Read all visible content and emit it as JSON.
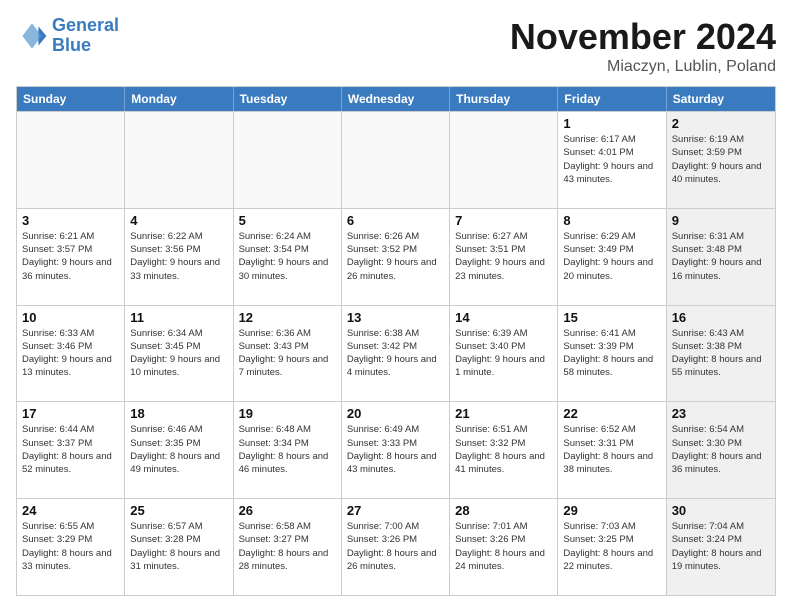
{
  "logo": {
    "line1": "General",
    "line2": "Blue"
  },
  "title": "November 2024",
  "location": "Miaczyn, Lublin, Poland",
  "weekdays": [
    "Sunday",
    "Monday",
    "Tuesday",
    "Wednesday",
    "Thursday",
    "Friday",
    "Saturday"
  ],
  "rows": [
    [
      {
        "day": "",
        "info": "",
        "empty": true
      },
      {
        "day": "",
        "info": "",
        "empty": true
      },
      {
        "day": "",
        "info": "",
        "empty": true
      },
      {
        "day": "",
        "info": "",
        "empty": true
      },
      {
        "day": "",
        "info": "",
        "empty": true
      },
      {
        "day": "1",
        "info": "Sunrise: 6:17 AM\nSunset: 4:01 PM\nDaylight: 9 hours and 43 minutes."
      },
      {
        "day": "2",
        "info": "Sunrise: 6:19 AM\nSunset: 3:59 PM\nDaylight: 9 hours and 40 minutes.",
        "shaded": true
      }
    ],
    [
      {
        "day": "3",
        "info": "Sunrise: 6:21 AM\nSunset: 3:57 PM\nDaylight: 9 hours and 36 minutes."
      },
      {
        "day": "4",
        "info": "Sunrise: 6:22 AM\nSunset: 3:56 PM\nDaylight: 9 hours and 33 minutes."
      },
      {
        "day": "5",
        "info": "Sunrise: 6:24 AM\nSunset: 3:54 PM\nDaylight: 9 hours and 30 minutes."
      },
      {
        "day": "6",
        "info": "Sunrise: 6:26 AM\nSunset: 3:52 PM\nDaylight: 9 hours and 26 minutes."
      },
      {
        "day": "7",
        "info": "Sunrise: 6:27 AM\nSunset: 3:51 PM\nDaylight: 9 hours and 23 minutes."
      },
      {
        "day": "8",
        "info": "Sunrise: 6:29 AM\nSunset: 3:49 PM\nDaylight: 9 hours and 20 minutes."
      },
      {
        "day": "9",
        "info": "Sunrise: 6:31 AM\nSunset: 3:48 PM\nDaylight: 9 hours and 16 minutes.",
        "shaded": true
      }
    ],
    [
      {
        "day": "10",
        "info": "Sunrise: 6:33 AM\nSunset: 3:46 PM\nDaylight: 9 hours and 13 minutes."
      },
      {
        "day": "11",
        "info": "Sunrise: 6:34 AM\nSunset: 3:45 PM\nDaylight: 9 hours and 10 minutes."
      },
      {
        "day": "12",
        "info": "Sunrise: 6:36 AM\nSunset: 3:43 PM\nDaylight: 9 hours and 7 minutes."
      },
      {
        "day": "13",
        "info": "Sunrise: 6:38 AM\nSunset: 3:42 PM\nDaylight: 9 hours and 4 minutes."
      },
      {
        "day": "14",
        "info": "Sunrise: 6:39 AM\nSunset: 3:40 PM\nDaylight: 9 hours and 1 minute."
      },
      {
        "day": "15",
        "info": "Sunrise: 6:41 AM\nSunset: 3:39 PM\nDaylight: 8 hours and 58 minutes."
      },
      {
        "day": "16",
        "info": "Sunrise: 6:43 AM\nSunset: 3:38 PM\nDaylight: 8 hours and 55 minutes.",
        "shaded": true
      }
    ],
    [
      {
        "day": "17",
        "info": "Sunrise: 6:44 AM\nSunset: 3:37 PM\nDaylight: 8 hours and 52 minutes."
      },
      {
        "day": "18",
        "info": "Sunrise: 6:46 AM\nSunset: 3:35 PM\nDaylight: 8 hours and 49 minutes."
      },
      {
        "day": "19",
        "info": "Sunrise: 6:48 AM\nSunset: 3:34 PM\nDaylight: 8 hours and 46 minutes."
      },
      {
        "day": "20",
        "info": "Sunrise: 6:49 AM\nSunset: 3:33 PM\nDaylight: 8 hours and 43 minutes."
      },
      {
        "day": "21",
        "info": "Sunrise: 6:51 AM\nSunset: 3:32 PM\nDaylight: 8 hours and 41 minutes."
      },
      {
        "day": "22",
        "info": "Sunrise: 6:52 AM\nSunset: 3:31 PM\nDaylight: 8 hours and 38 minutes."
      },
      {
        "day": "23",
        "info": "Sunrise: 6:54 AM\nSunset: 3:30 PM\nDaylight: 8 hours and 36 minutes.",
        "shaded": true
      }
    ],
    [
      {
        "day": "24",
        "info": "Sunrise: 6:55 AM\nSunset: 3:29 PM\nDaylight: 8 hours and 33 minutes."
      },
      {
        "day": "25",
        "info": "Sunrise: 6:57 AM\nSunset: 3:28 PM\nDaylight: 8 hours and 31 minutes."
      },
      {
        "day": "26",
        "info": "Sunrise: 6:58 AM\nSunset: 3:27 PM\nDaylight: 8 hours and 28 minutes."
      },
      {
        "day": "27",
        "info": "Sunrise: 7:00 AM\nSunset: 3:26 PM\nDaylight: 8 hours and 26 minutes."
      },
      {
        "day": "28",
        "info": "Sunrise: 7:01 AM\nSunset: 3:26 PM\nDaylight: 8 hours and 24 minutes."
      },
      {
        "day": "29",
        "info": "Sunrise: 7:03 AM\nSunset: 3:25 PM\nDaylight: 8 hours and 22 minutes."
      },
      {
        "day": "30",
        "info": "Sunrise: 7:04 AM\nSunset: 3:24 PM\nDaylight: 8 hours and 19 minutes.",
        "shaded": true
      }
    ]
  ]
}
